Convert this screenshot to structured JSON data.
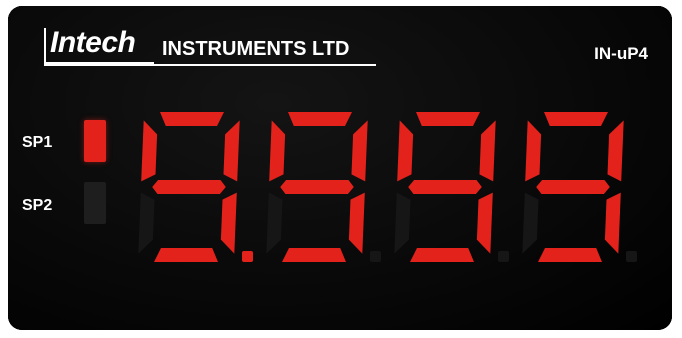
{
  "brand": {
    "name": "Intech",
    "subtitle": "INSTRUMENTS LTD"
  },
  "model": "IN-uP4",
  "setpoints": [
    {
      "label": "SP1",
      "state": "on",
      "color": "#e3231b"
    },
    {
      "label": "SP2",
      "state": "off",
      "color": "#1e1e1e"
    }
  ],
  "display": {
    "reading": "9.999",
    "digits": [
      "9",
      "9",
      "9",
      "9"
    ],
    "decimal_after_digit": 1,
    "segment_on_color": "#e3231b",
    "segment_off_color": "#161616"
  }
}
